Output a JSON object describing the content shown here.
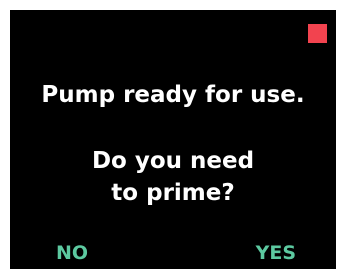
{
  "screen": {
    "status_message": "Pump ready for use.",
    "question_line_1": "Do you need",
    "question_line_2": "to prime?",
    "status_indicator_color": "#f2434f"
  },
  "softkeys": {
    "left_label": "NO",
    "right_label": "YES",
    "color": "#5cc9a0"
  }
}
